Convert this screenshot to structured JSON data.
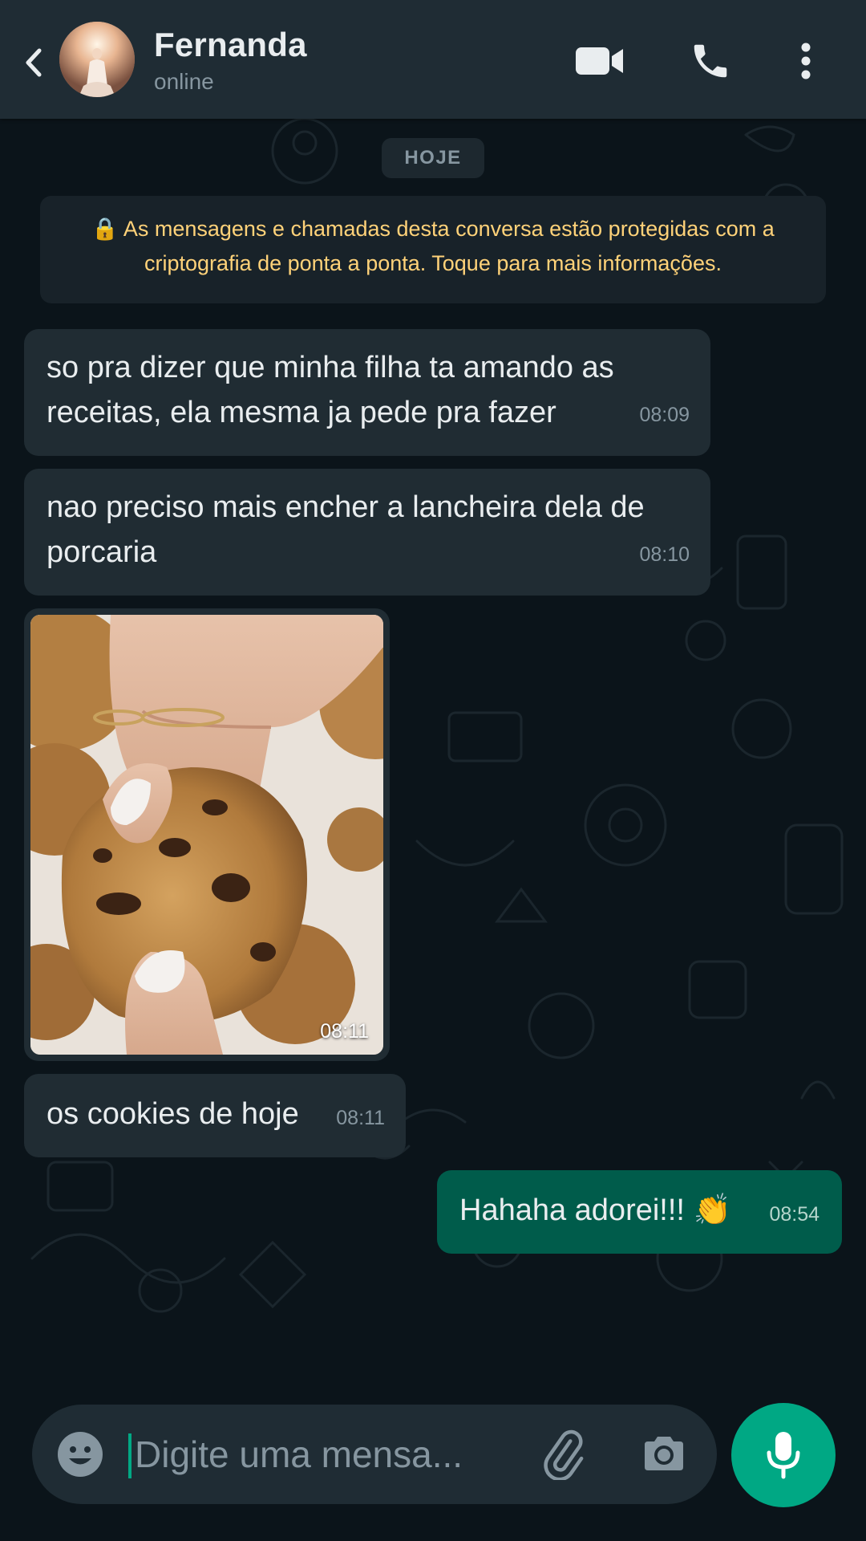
{
  "header": {
    "contact_name": "Fernanda",
    "status": "online"
  },
  "chat": {
    "date_chip": "HOJE",
    "encryption_notice": "As mensagens e chamadas desta conversa estão protegidas com a criptografia de ponta a ponta. Toque para mais informações.",
    "messages": [
      {
        "direction": "in",
        "text": "so pra dizer que minha filha ta amando as receitas, ela mesma ja pede pra fazer",
        "time": "08:09"
      },
      {
        "direction": "in",
        "text": "nao preciso mais encher a lancheira dela de porcaria",
        "time": "08:10"
      },
      {
        "direction": "in",
        "type": "image",
        "image_subject": "hand holding chocolate chip cookie",
        "time": "08:11"
      },
      {
        "direction": "in",
        "text": "os cookies de hoje",
        "time": "08:11"
      },
      {
        "direction": "out",
        "text": "Hahaha adorei!!! 👏",
        "time": "08:54"
      }
    ]
  },
  "composer": {
    "placeholder": "Digite uma mensa...",
    "value": ""
  },
  "icons": {
    "back": "chevron-left-icon",
    "video": "video-camera-icon",
    "call": "phone-icon",
    "more": "more-vertical-icon",
    "emoji": "emoji-icon",
    "attach": "paperclip-icon",
    "camera": "camera-icon",
    "mic": "microphone-icon"
  },
  "colors": {
    "header_bg": "#1f2c34",
    "chat_bg": "#0b141a",
    "incoming_bubble": "#202c33",
    "outgoing_bubble": "#005c4b",
    "accent": "#00a884",
    "notice_text": "#ffd279"
  }
}
